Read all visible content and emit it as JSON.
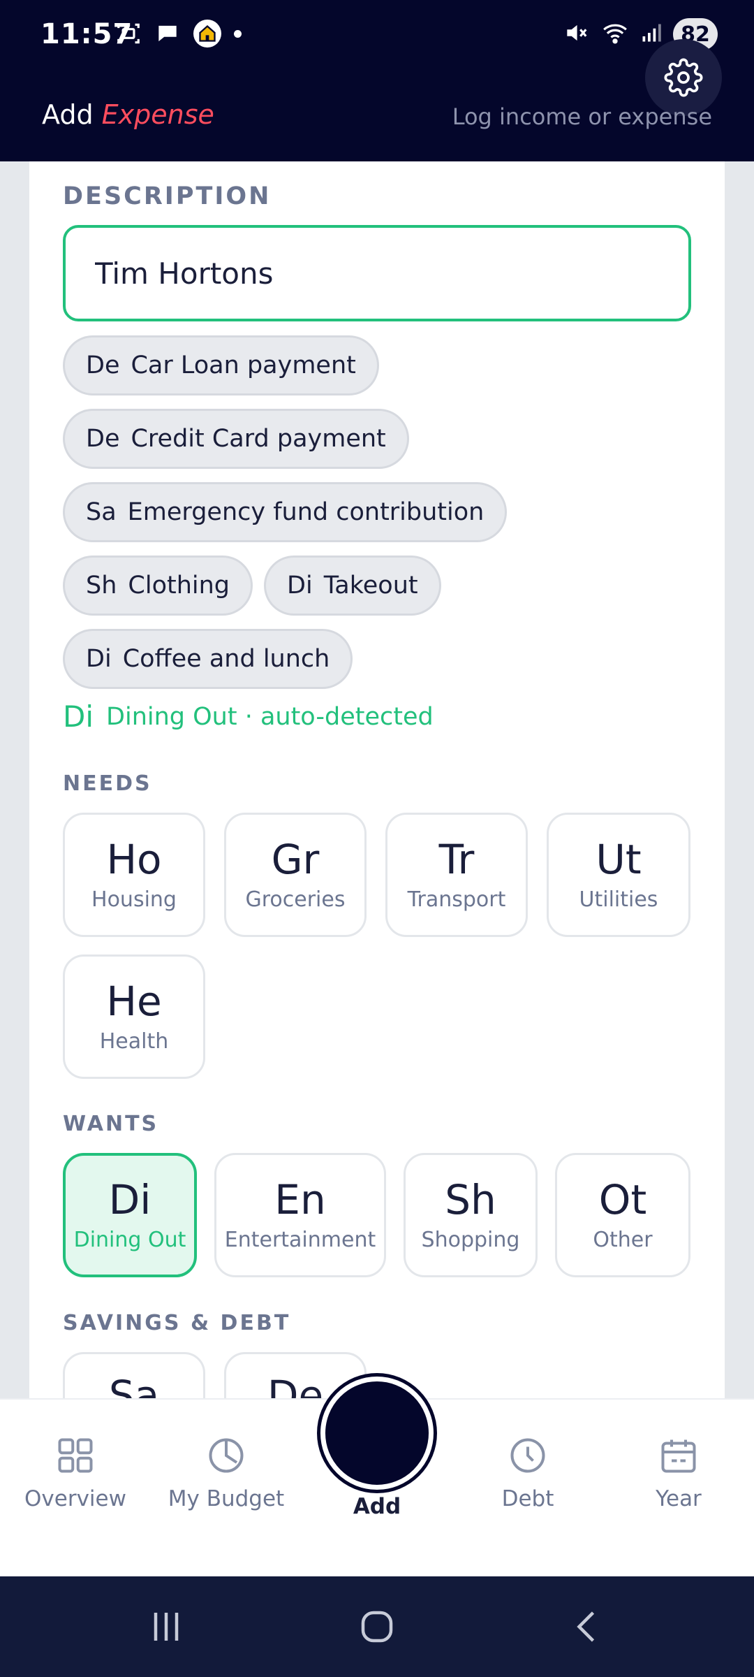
{
  "status_bar": {
    "time": "11:57",
    "battery": "82"
  },
  "header": {
    "title_prefix": "Add",
    "title_accent": "Expense",
    "subtitle": "Log income or expense",
    "accent_color": "#ff4d5e"
  },
  "form": {
    "description_label": "DESCRIPTION",
    "description_value": "Tim Hortons",
    "suggestions": [
      {
        "abbr": "De",
        "label": "Car Loan payment"
      },
      {
        "abbr": "De",
        "label": "Credit Card payment"
      },
      {
        "abbr": "Sa",
        "label": "Emergency fund contribution"
      },
      {
        "abbr": "Sh",
        "label": "Clothing"
      },
      {
        "abbr": "Di",
        "label": "Takeout"
      },
      {
        "abbr": "Di",
        "label": "Coffee and lunch"
      }
    ],
    "detected": {
      "abbr": "Di",
      "text": "Dining Out · auto-detected"
    },
    "accent_color": "#22c07c"
  },
  "needs": {
    "label": "NEEDS",
    "items": [
      {
        "abbr": "Ho",
        "name": "Housing"
      },
      {
        "abbr": "Gr",
        "name": "Groceries"
      },
      {
        "abbr": "Tr",
        "name": "Transport"
      },
      {
        "abbr": "Ut",
        "name": "Utilities"
      },
      {
        "abbr": "He",
        "name": "Health"
      }
    ]
  },
  "wants": {
    "label": "WANTS",
    "items": [
      {
        "abbr": "Di",
        "name": "Dining Out",
        "selected": true
      },
      {
        "abbr": "En",
        "name": "Entertainment"
      },
      {
        "abbr": "Sh",
        "name": "Shopping"
      },
      {
        "abbr": "Ot",
        "name": "Other"
      }
    ]
  },
  "savings_debt": {
    "label": "SAVINGS & DEBT",
    "items": [
      {
        "abbr": "Sa"
      },
      {
        "abbr": "De"
      }
    ]
  },
  "bottom_nav": {
    "items": [
      {
        "label": "Overview",
        "icon": "grid-icon"
      },
      {
        "label": "My Budget",
        "icon": "pie-clock-icon"
      },
      {
        "label": "Add",
        "icon": "add-circle-icon"
      },
      {
        "label": "Debt",
        "icon": "clock-icon"
      },
      {
        "label": "Year",
        "icon": "calendar-icon"
      }
    ]
  }
}
